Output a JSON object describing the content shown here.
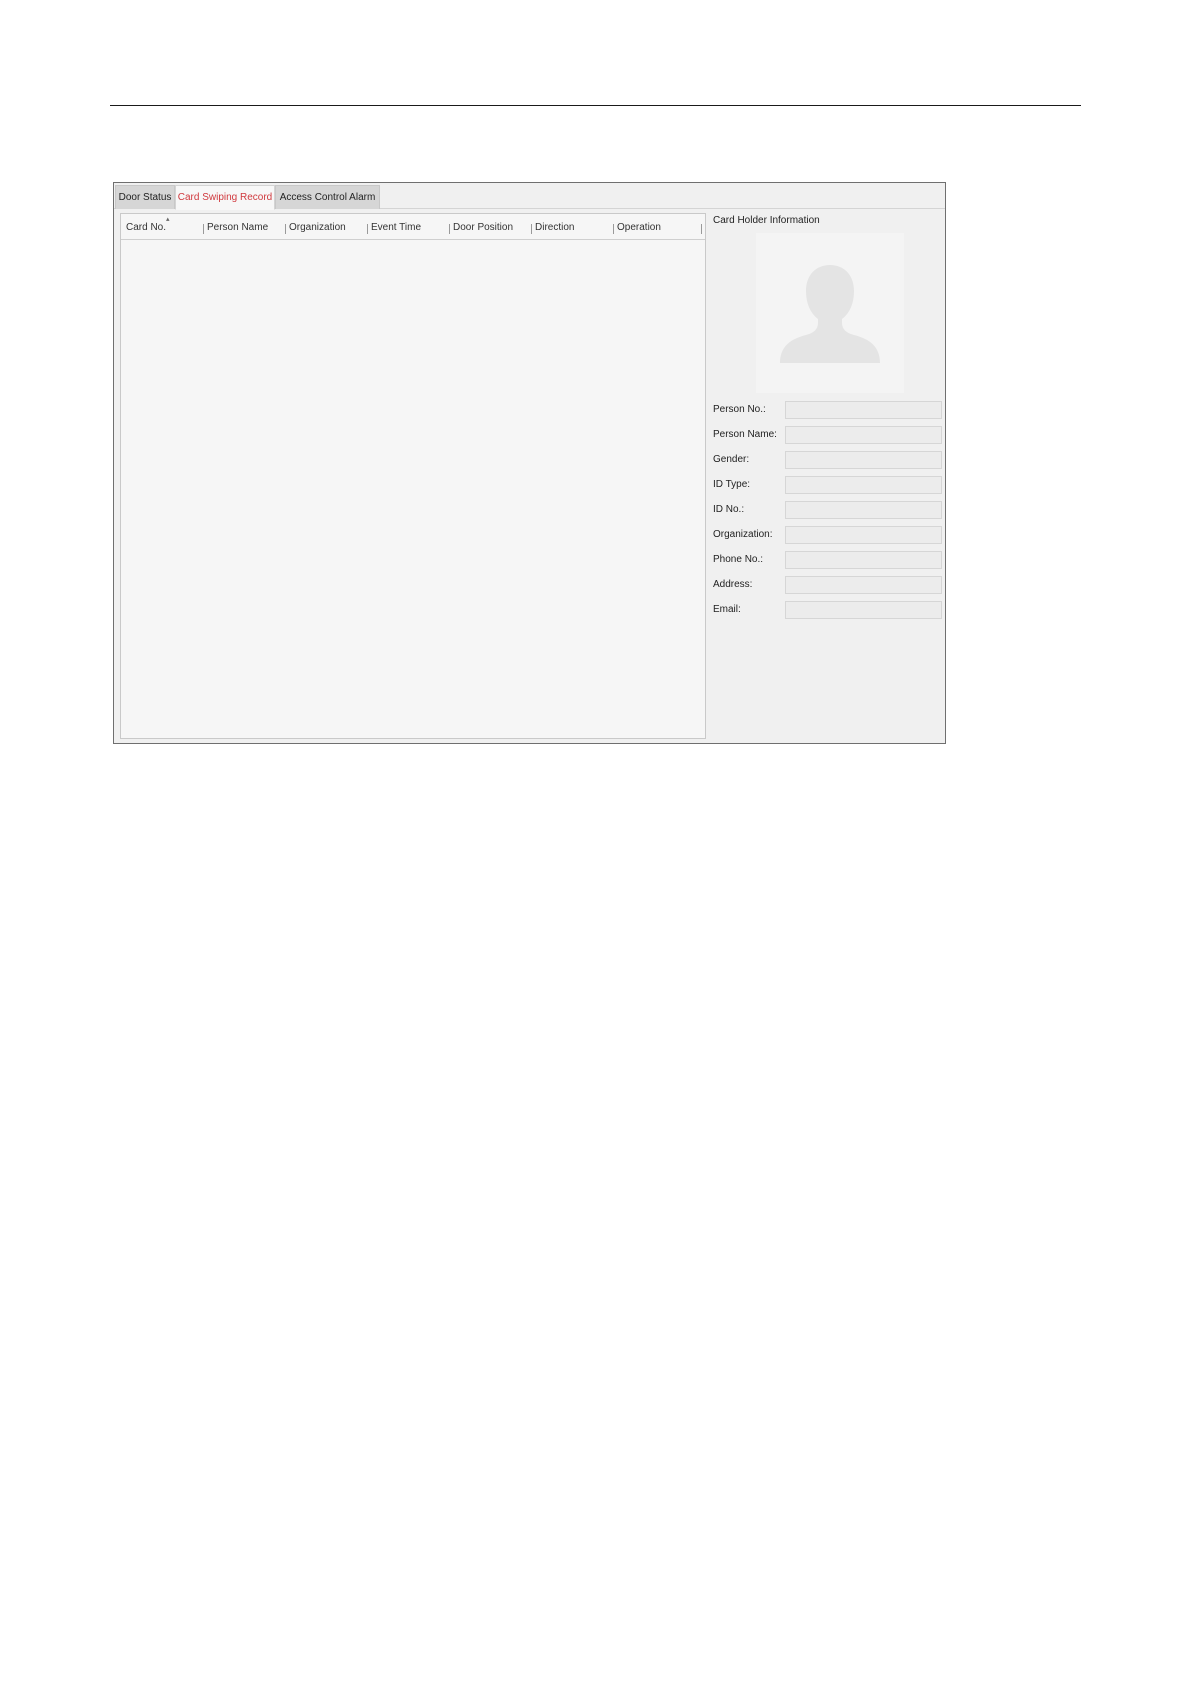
{
  "tabs": [
    {
      "label": "Door Status",
      "active": false
    },
    {
      "label": "Card Swiping Record",
      "active": true
    },
    {
      "label": "Access Control Alarm",
      "active": false
    }
  ],
  "table": {
    "columns": [
      "Card No.",
      "Person Name",
      "Organization",
      "Event Time",
      "Door Position",
      "Direction",
      "Operation"
    ],
    "sort_column": "Card No.",
    "rows": []
  },
  "card_holder": {
    "title": "Card Holder Information",
    "photo_icon": "person-silhouette-icon",
    "fields": [
      {
        "label": "Person No.:",
        "value": ""
      },
      {
        "label": "Person Name:",
        "value": ""
      },
      {
        "label": "Gender:",
        "value": ""
      },
      {
        "label": "ID Type:",
        "value": ""
      },
      {
        "label": "ID No.:",
        "value": ""
      },
      {
        "label": "Organization:",
        "value": ""
      },
      {
        "label": "Phone No.:",
        "value": ""
      },
      {
        "label": "Address:",
        "value": ""
      },
      {
        "label": "Email:",
        "value": ""
      }
    ]
  },
  "colors": {
    "active_tab_text": "#d0393e",
    "window_border": "#6f6f6f"
  }
}
